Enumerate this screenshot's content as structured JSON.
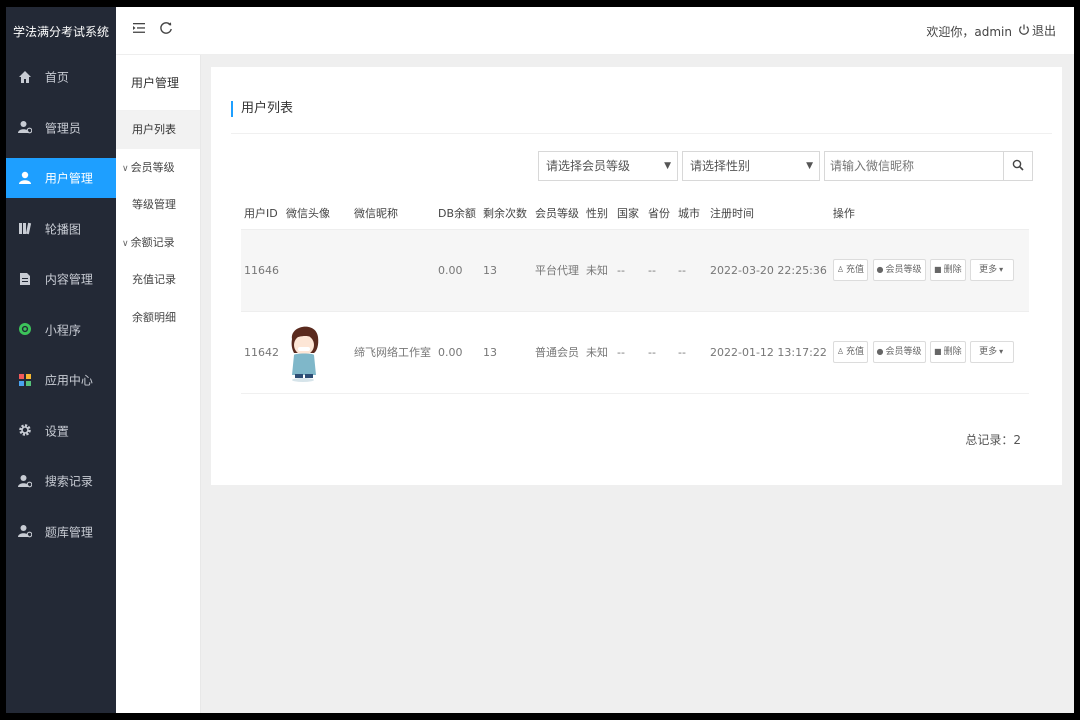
{
  "app": {
    "title": "学法满分考试系统"
  },
  "sidebar": {
    "items": [
      {
        "label": "首页",
        "icon": "home-icon"
      },
      {
        "label": "管理员",
        "icon": "admin-user-icon"
      },
      {
        "label": "用户管理",
        "icon": "user-icon",
        "active": true
      },
      {
        "label": "轮播图",
        "icon": "carousel-icon"
      },
      {
        "label": "内容管理",
        "icon": "document-icon"
      },
      {
        "label": "小程序",
        "icon": "miniprogram-icon"
      },
      {
        "label": "应用中心",
        "icon": "apps-icon"
      },
      {
        "label": "设置",
        "icon": "gear-icon"
      },
      {
        "label": "搜索记录",
        "icon": "search-record-icon"
      },
      {
        "label": "题库管理",
        "icon": "question-bank-icon"
      }
    ]
  },
  "submenu": {
    "title": "用户管理",
    "items": [
      {
        "label": "用户列表",
        "active": true
      },
      {
        "label": "会员等级",
        "group": true
      },
      {
        "label": "等级管理"
      },
      {
        "label": "余额记录",
        "group": true
      },
      {
        "label": "充值记录"
      },
      {
        "label": "余额明细"
      }
    ]
  },
  "topbar": {
    "welcome": "欢迎你，admin",
    "logout": "退出"
  },
  "page": {
    "title": "用户列表",
    "total": "总记录：2"
  },
  "filters": {
    "level_select": "请选择会员等级",
    "gender_select": "请选择性别",
    "search_placeholder": "请输入微信昵称"
  },
  "table": {
    "columns": [
      "用户ID",
      "微信头像",
      "微信昵称",
      "DB余额",
      "剩余次数",
      "会员等级",
      "性别",
      "国家",
      "省份",
      "城市",
      "注册时间",
      "操作"
    ],
    "rows": [
      {
        "id": "11646",
        "avatar": "",
        "nickname": "",
        "balance": "0.00",
        "remaining": "13",
        "level": "平台代理",
        "gender": "未知",
        "country": "--",
        "province": "--",
        "city": "--",
        "registered": "2022-03-20 22:25:36"
      },
      {
        "id": "11642",
        "avatar": "cartoon-boy-avatar",
        "nickname": "缔飞网络工作室",
        "balance": "0.00",
        "remaining": "13",
        "level": "普通会员",
        "gender": "未知",
        "country": "--",
        "province": "--",
        "city": "--",
        "registered": "2022-01-12 13:17:22"
      }
    ],
    "actions": {
      "recharge": "充值",
      "member_level": "会员等级",
      "delete": "删除",
      "more": "更多"
    }
  },
  "colors": {
    "sidebar_bg": "#232936",
    "accent": "#1e9fff",
    "page_bg": "#efefef"
  }
}
